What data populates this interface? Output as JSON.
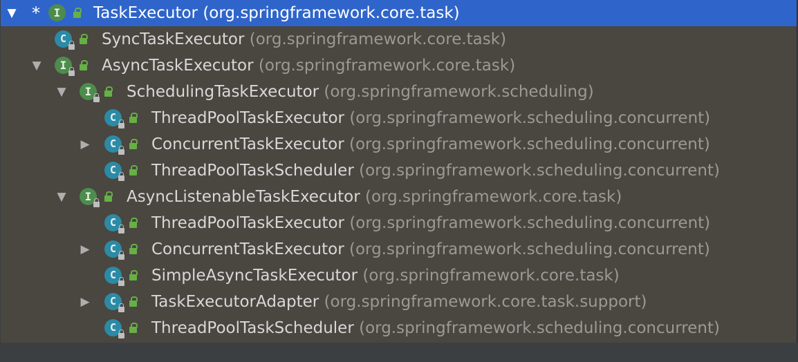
{
  "tree": {
    "rows": [
      {
        "name": "TaskExecutor",
        "pkg": "(org.springframework.core.task)",
        "kind": "interface",
        "icon_letter": "I",
        "marker": "*",
        "expanded": true,
        "selected": true
      },
      {
        "name": "SyncTaskExecutor",
        "pkg": "(org.springframework.core.task)",
        "kind": "class",
        "icon_letter": "C",
        "expanded": null
      },
      {
        "name": "AsyncTaskExecutor",
        "pkg": "(org.springframework.core.task)",
        "kind": "interface",
        "icon_letter": "I",
        "expanded": true
      },
      {
        "name": "SchedulingTaskExecutor",
        "pkg": "(org.springframework.scheduling)",
        "kind": "interface",
        "icon_letter": "I",
        "expanded": true
      },
      {
        "name": "ThreadPoolTaskExecutor",
        "pkg": "(org.springframework.scheduling.concurrent)",
        "kind": "class",
        "icon_letter": "C",
        "expanded": null
      },
      {
        "name": "ConcurrentTaskExecutor",
        "pkg": "(org.springframework.scheduling.concurrent)",
        "kind": "class",
        "icon_letter": "C",
        "expanded": false
      },
      {
        "name": "ThreadPoolTaskScheduler",
        "pkg": "(org.springframework.scheduling.concurrent)",
        "kind": "class",
        "icon_letter": "C",
        "expanded": null
      },
      {
        "name": "AsyncListenableTaskExecutor",
        "pkg": "(org.springframework.core.task)",
        "kind": "interface",
        "icon_letter": "I",
        "expanded": true
      },
      {
        "name": "ThreadPoolTaskExecutor",
        "pkg": "(org.springframework.scheduling.concurrent)",
        "kind": "class",
        "icon_letter": "C",
        "expanded": null
      },
      {
        "name": "ConcurrentTaskExecutor",
        "pkg": "(org.springframework.scheduling.concurrent)",
        "kind": "class",
        "icon_letter": "C",
        "expanded": false
      },
      {
        "name": "SimpleAsyncTaskExecutor",
        "pkg": "(org.springframework.core.task)",
        "kind": "class",
        "icon_letter": "C",
        "expanded": null
      },
      {
        "name": "TaskExecutorAdapter",
        "pkg": "(org.springframework.core.task.support)",
        "kind": "class",
        "icon_letter": "C",
        "expanded": false
      },
      {
        "name": "ThreadPoolTaskScheduler",
        "pkg": "(org.springframework.scheduling.concurrent)",
        "kind": "class",
        "icon_letter": "C",
        "expanded": null
      }
    ]
  },
  "icons": {
    "expanded": "triangle-down-icon",
    "collapsed": "triangle-right-icon",
    "interface": "interface-icon",
    "class": "class-icon",
    "visibility": "public-lock-icon"
  },
  "colors": {
    "background": "#4a4640",
    "selection": "#2f65ca",
    "interface_icon": "#4d8c4d",
    "class_icon": "#2c8aa5",
    "public_marker": "#66b046",
    "package_text": "#9a9a96"
  }
}
